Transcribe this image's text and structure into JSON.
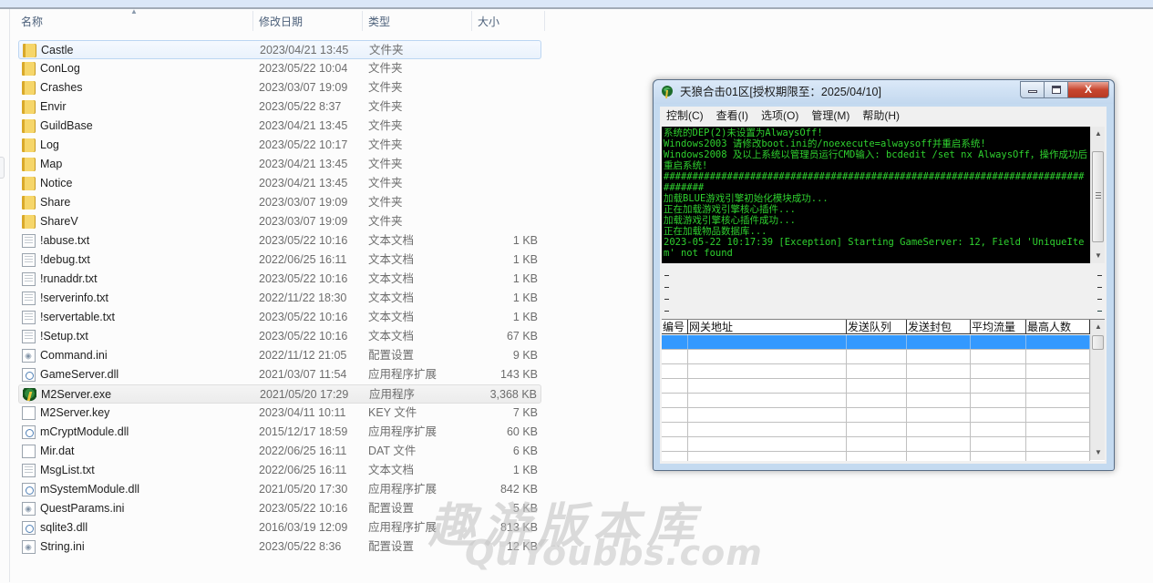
{
  "explorer": {
    "columns": [
      {
        "key": "name",
        "label": "名称"
      },
      {
        "key": "date",
        "label": "修改日期"
      },
      {
        "key": "type",
        "label": "类型"
      },
      {
        "key": "size",
        "label": "大小"
      }
    ],
    "sort_indicator": "▲",
    "files": [
      {
        "icon": "folder-icon",
        "name": "Castle",
        "date": "2023/04/21 13:45",
        "type": "文件夹",
        "size": "",
        "state": "selected"
      },
      {
        "icon": "folder-icon",
        "name": "ConLog",
        "date": "2023/05/22 10:04",
        "type": "文件夹",
        "size": ""
      },
      {
        "icon": "folder-icon",
        "name": "Crashes",
        "date": "2023/03/07 19:09",
        "type": "文件夹",
        "size": ""
      },
      {
        "icon": "folder-icon",
        "name": "Envir",
        "date": "2023/05/22 8:37",
        "type": "文件夹",
        "size": ""
      },
      {
        "icon": "folder-icon",
        "name": "GuildBase",
        "date": "2023/04/21 13:45",
        "type": "文件夹",
        "size": ""
      },
      {
        "icon": "folder-icon",
        "name": "Log",
        "date": "2023/05/22 10:17",
        "type": "文件夹",
        "size": ""
      },
      {
        "icon": "folder-icon",
        "name": "Map",
        "date": "2023/04/21 13:45",
        "type": "文件夹",
        "size": ""
      },
      {
        "icon": "folder-icon",
        "name": "Notice",
        "date": "2023/04/21 13:45",
        "type": "文件夹",
        "size": ""
      },
      {
        "icon": "folder-icon",
        "name": "Share",
        "date": "2023/03/07 19:09",
        "type": "文件夹",
        "size": ""
      },
      {
        "icon": "folder-icon",
        "name": "ShareV",
        "date": "2023/03/07 19:09",
        "type": "文件夹",
        "size": ""
      },
      {
        "icon": "text-file-icon",
        "name": "!abuse.txt",
        "date": "2023/05/22 10:16",
        "type": "文本文档",
        "size": "1 KB"
      },
      {
        "icon": "text-file-icon",
        "name": "!debug.txt",
        "date": "2022/06/25 16:11",
        "type": "文本文档",
        "size": "1 KB"
      },
      {
        "icon": "text-file-icon",
        "name": "!runaddr.txt",
        "date": "2023/05/22 10:16",
        "type": "文本文档",
        "size": "1 KB"
      },
      {
        "icon": "text-file-icon",
        "name": "!serverinfo.txt",
        "date": "2022/11/22 18:30",
        "type": "文本文档",
        "size": "1 KB"
      },
      {
        "icon": "text-file-icon",
        "name": "!servertable.txt",
        "date": "2023/05/22 10:16",
        "type": "文本文档",
        "size": "1 KB"
      },
      {
        "icon": "text-file-icon",
        "name": "!Setup.txt",
        "date": "2023/05/22 10:16",
        "type": "文本文档",
        "size": "67 KB"
      },
      {
        "icon": "ini-file-icon",
        "name": "Command.ini",
        "date": "2022/11/12 21:05",
        "type": "配置设置",
        "size": "9 KB"
      },
      {
        "icon": "dll-file-icon",
        "name": "GameServer.dll",
        "date": "2021/03/07 11:54",
        "type": "应用程序扩展",
        "size": "143 KB"
      },
      {
        "icon": "exe-app-icon",
        "name": "M2Server.exe",
        "date": "2021/05/20 17:29",
        "type": "应用程序",
        "size": "3,368 KB",
        "state": "hover"
      },
      {
        "icon": "blank-file-icon",
        "name": "M2Server.key",
        "date": "2023/04/11 10:11",
        "type": "KEY 文件",
        "size": "7 KB"
      },
      {
        "icon": "dll-file-icon",
        "name": "mCryptModule.dll",
        "date": "2015/12/17 18:59",
        "type": "应用程序扩展",
        "size": "60 KB"
      },
      {
        "icon": "blank-file-icon",
        "name": "Mir.dat",
        "date": "2022/06/25 16:11",
        "type": "DAT 文件",
        "size": "6 KB"
      },
      {
        "icon": "text-file-icon",
        "name": "MsgList.txt",
        "date": "2022/06/25 16:11",
        "type": "文本文档",
        "size": "1 KB"
      },
      {
        "icon": "dll-file-icon",
        "name": "mSystemModule.dll",
        "date": "2021/05/20 17:30",
        "type": "应用程序扩展",
        "size": "842 KB"
      },
      {
        "icon": "ini-file-icon",
        "name": "QuestParams.ini",
        "date": "2023/05/22 10:16",
        "type": "配置设置",
        "size": "5 KB"
      },
      {
        "icon": "dll-file-icon",
        "name": "sqlite3.dll",
        "date": "2016/03/19 12:09",
        "type": "应用程序扩展",
        "size": "813 KB"
      },
      {
        "icon": "ini-file-icon",
        "name": "String.ini",
        "date": "2023/05/22 8:36",
        "type": "配置设置",
        "size": "12 KB"
      }
    ]
  },
  "watermark": {
    "line1": "趣游版本库",
    "line2": "QuYoubbs.com"
  },
  "server_window": {
    "title": "天狼合击01区[授权期限至：2025/04/10]",
    "caption_buttons": {
      "minimize": "minimize",
      "maximize": "maximize",
      "close": "X"
    },
    "menu": [
      "控制(C)",
      "查看(I)",
      "选项(O)",
      "管理(M)",
      "帮助(H)"
    ],
    "console_color": "#2fd12f",
    "console_lines": [
      "系统的DEP(2)未设置为AlwaysOff!",
      "Windows2003 请修改boot.ini的/noexecute=alwaysoff并重启系统!",
      "Windows2008 及以上系统以管理员运行CMD输入: bcdedit /set nx AlwaysOff，操作成功后重启系统!",
      "################################################################################",
      "加载BLUE游戏引擎初始化模块成功...",
      "正在加载游戏引擎核心插件...",
      "加载游戏引擎核心插件成功...",
      "正在加载物品数据库...",
      "2023-05-22 10:17:39 [Exception] Starting GameServer: 12, Field 'UniqueItem' not found"
    ],
    "status_lines": [
      "-",
      "-",
      "-",
      "-"
    ],
    "gateway_table": {
      "columns": [
        "编号",
        "网关地址",
        "发送队列",
        "发送封包",
        "平均流量",
        "最高人数"
      ],
      "selected_row_color": "#3399ff",
      "rows": []
    }
  }
}
